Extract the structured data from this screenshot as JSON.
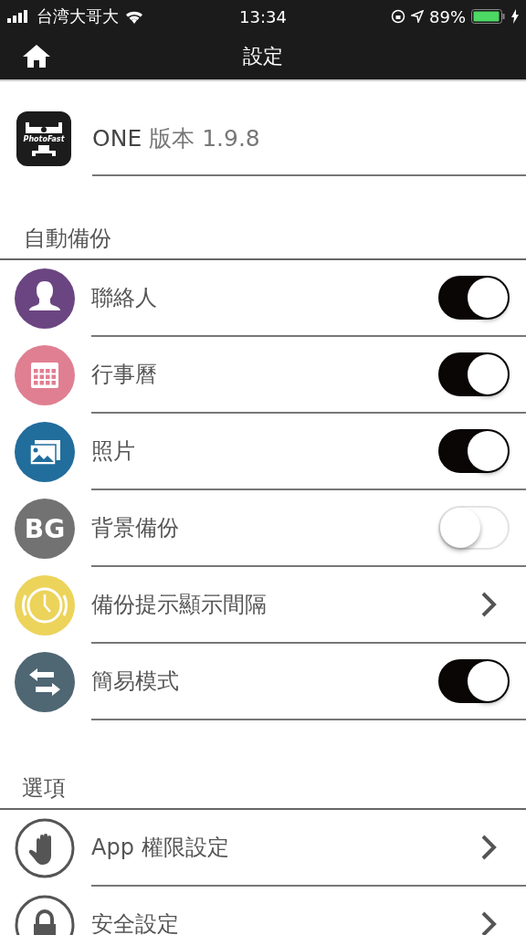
{
  "status_bar": {
    "carrier": "台湾大哥大",
    "time": "13:34",
    "battery": "89%"
  },
  "nav": {
    "title": "設定"
  },
  "app_info": {
    "logo_text": "PhotoFast",
    "name": "ONE",
    "version": "版本 1.9.8"
  },
  "sections": [
    {
      "title": "自動備份",
      "items": [
        {
          "label": "聯絡人",
          "kind": "toggle",
          "checked": true,
          "color": "#6b4581"
        },
        {
          "label": "行事曆",
          "kind": "toggle",
          "checked": true,
          "color": "#e07f92"
        },
        {
          "label": "照片",
          "kind": "toggle",
          "checked": true,
          "color": "#216d9c"
        },
        {
          "label": "背景備份",
          "kind": "toggle",
          "checked": false,
          "color": "#727272",
          "icon_text": "BG"
        },
        {
          "label": "備份提示顯示間隔",
          "kind": "chevron",
          "color": "#ecd35a"
        },
        {
          "label": "簡易模式",
          "kind": "toggle",
          "checked": true,
          "color": "#4f6673"
        }
      ]
    },
    {
      "title": "選項",
      "items": [
        {
          "label": "App 權限設定",
          "kind": "chevron"
        },
        {
          "label": "安全設定",
          "kind": "chevron"
        }
      ]
    }
  ]
}
